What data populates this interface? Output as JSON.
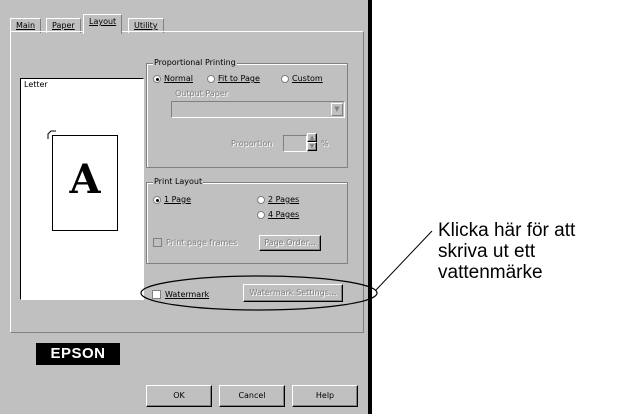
{
  "tabs": [
    {
      "label": "Main"
    },
    {
      "label": "Paper"
    },
    {
      "label": "Layout"
    },
    {
      "label": "Utility"
    }
  ],
  "preview": {
    "paper_label": "Letter",
    "page_letter": "A"
  },
  "proportional_printing": {
    "title": "Proportional Printing",
    "options": [
      {
        "label": "Normal",
        "selected": true
      },
      {
        "label": "Fit to Page",
        "selected": false
      },
      {
        "label": "Custom",
        "selected": false
      }
    ],
    "output_paper_label": "Output Paper",
    "output_paper_value": "",
    "proportion_label": "Proportion",
    "proportion_value": "",
    "proportion_unit": "%"
  },
  "print_layout": {
    "title": "Print Layout",
    "options": [
      {
        "label": "1 Page",
        "selected": true
      },
      {
        "label": "2 Pages",
        "selected": false
      },
      {
        "label": "4 Pages",
        "selected": false
      }
    ],
    "print_border_label": "Print page frames",
    "page_order_button": "Page Order..."
  },
  "watermark": {
    "label": "Watermark",
    "settings_button": "Watermark Settings..."
  },
  "brand": "EPSON",
  "buttons": {
    "ok": "OK",
    "cancel": "Cancel",
    "help": "Help"
  },
  "annotation": {
    "lines": [
      "Klicka här för att",
      "skriva ut ett",
      "vattenmärke"
    ]
  }
}
